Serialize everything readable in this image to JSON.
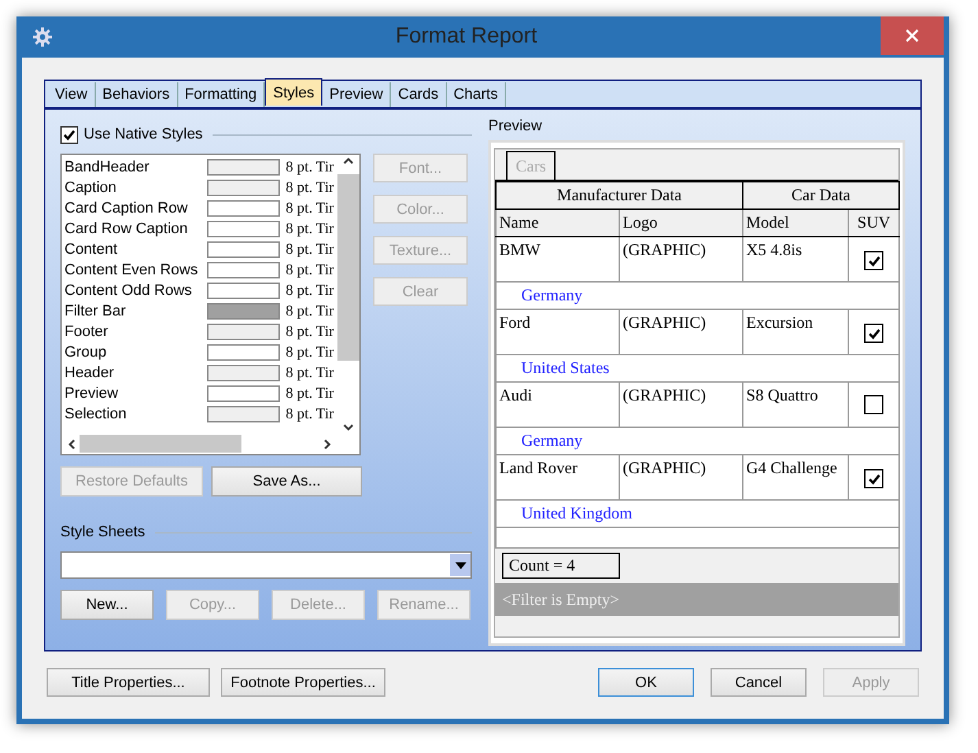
{
  "window": {
    "title": "Format Report"
  },
  "tabs": [
    {
      "label": "View",
      "selected": false
    },
    {
      "label": "Behaviors",
      "selected": false
    },
    {
      "label": "Formatting",
      "selected": false
    },
    {
      "label": "Styles",
      "selected": true
    },
    {
      "label": "Preview",
      "selected": false
    },
    {
      "label": "Cards",
      "selected": false
    },
    {
      "label": "Charts",
      "selected": false
    }
  ],
  "native_styles": {
    "label": "Use Native Styles",
    "checked": true
  },
  "styles": [
    {
      "name": "BandHeader",
      "color": "#efefef",
      "font": "8 pt. Tir"
    },
    {
      "name": "Caption",
      "color": "#efefef",
      "font": "8 pt. Tir"
    },
    {
      "name": "Card Caption Row",
      "color": "#ffffff",
      "font": "8 pt. Tir"
    },
    {
      "name": "Card Row Caption",
      "color": "#ffffff",
      "font": "8 pt. Tir"
    },
    {
      "name": "Content",
      "color": "#ffffff",
      "font": "8 pt. Tir"
    },
    {
      "name": "Content Even Rows",
      "color": "#ffffff",
      "font": "8 pt. Tir"
    },
    {
      "name": "Content Odd Rows",
      "color": "#ffffff",
      "font": "8 pt. Tir"
    },
    {
      "name": "Filter Bar",
      "color": "#a0a0a0",
      "font": "8 pt. Tir"
    },
    {
      "name": "Footer",
      "color": "#efefef",
      "font": "8 pt. Tir"
    },
    {
      "name": "Group",
      "color": "#ffffff",
      "font": "8 pt. Tir"
    },
    {
      "name": "Header",
      "color": "#efefef",
      "font": "8 pt. Tir"
    },
    {
      "name": "Preview",
      "color": "#ffffff",
      "font": "8 pt. Tir"
    },
    {
      "name": "Selection",
      "color": "#efefef",
      "font": "8 pt. Tir"
    }
  ],
  "style_buttons": [
    {
      "label": "Font...",
      "disabled": true
    },
    {
      "label": "Color...",
      "disabled": true
    },
    {
      "label": "Texture...",
      "disabled": true
    },
    {
      "label": "Clear",
      "disabled": true
    }
  ],
  "list_buttons": [
    {
      "label": "Restore Defaults",
      "disabled": true
    },
    {
      "label": "Save As...",
      "disabled": false
    }
  ],
  "style_sheets": {
    "label": "Style Sheets",
    "buttons": [
      {
        "label": "New...",
        "disabled": false
      },
      {
        "label": "Copy...",
        "disabled": true
      },
      {
        "label": "Delete...",
        "disabled": true
      },
      {
        "label": "Rename...",
        "disabled": true
      }
    ]
  },
  "preview": {
    "label": "Preview",
    "tab": "Cars",
    "group_headers": [
      "Manufacturer Data",
      "Car Data"
    ],
    "columns": [
      "Name",
      "Logo",
      "Model",
      "SUV"
    ],
    "rows": [
      {
        "name": "BMW",
        "logo": "(GRAPHIC)",
        "model": "X5 4.8is",
        "suv": true,
        "group": "Germany"
      },
      {
        "name": "Ford",
        "logo": "(GRAPHIC)",
        "model": "Excursion",
        "suv": true,
        "group": "United States"
      },
      {
        "name": "Audi",
        "logo": "(GRAPHIC)",
        "model": "S8 Quattro",
        "suv": false,
        "group": "Germany"
      },
      {
        "name": "Land Rover",
        "logo": "(GRAPHIC)",
        "model": "G4 Challenge",
        "suv": true,
        "group": "United Kingdom"
      }
    ],
    "count": "Count = 4",
    "filter": "<Filter is Empty>"
  },
  "footer_left": [
    {
      "label": "Title Properties...",
      "disabled": false
    },
    {
      "label": "Footnote Properties...",
      "disabled": false
    }
  ],
  "footer_right": [
    {
      "label": "OK",
      "disabled": false,
      "default": true
    },
    {
      "label": "Cancel",
      "disabled": false,
      "default": false
    },
    {
      "label": "Apply",
      "disabled": true,
      "default": false
    }
  ]
}
